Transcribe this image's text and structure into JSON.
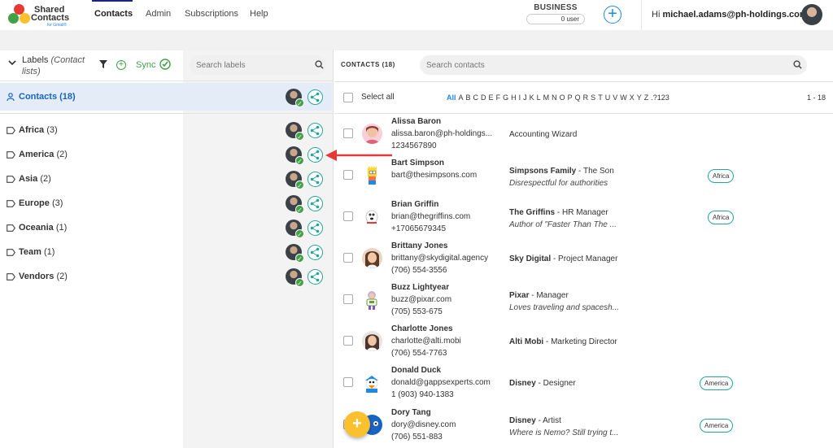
{
  "header": {
    "logo": {
      "line1": "Shared",
      "line2": "Contacts",
      "line3": "for Gmail®"
    },
    "nav": [
      "Contacts",
      "Admin",
      "Subscriptions",
      "Help"
    ],
    "plan_name": "BUSINESS",
    "plan_users": "0 user",
    "greeting_prefix": "Hi ",
    "greeting_email": "michael.adams@ph-holdings.com",
    "greeting_suffix": "!"
  },
  "labels_panel": {
    "title": "Labels",
    "title_italic": "(Contact lists)",
    "sync_label": "Sync",
    "search_placeholder": "Search labels",
    "contacts_item": "Contacts (18)",
    "items": [
      {
        "name": "Africa",
        "count": "(3)"
      },
      {
        "name": "America",
        "count": "(2)"
      },
      {
        "name": "Asia",
        "count": "(2)"
      },
      {
        "name": "Europe",
        "count": "(3)"
      },
      {
        "name": "Oceania",
        "count": "(1)"
      },
      {
        "name": "Team",
        "count": "(1)"
      },
      {
        "name": "Vendors",
        "count": "(2)"
      }
    ]
  },
  "contacts_panel": {
    "title": "CONTACTS (18)",
    "search_placeholder": "Search contacts",
    "select_all": "Select all",
    "alphabet": [
      "All",
      "A",
      "B",
      "C",
      "D",
      "E",
      "F",
      "G",
      "H",
      "I",
      "J",
      "K",
      "L",
      "M",
      "N",
      "O",
      "P",
      "Q",
      "R",
      "S",
      "T",
      "U",
      "V",
      "W",
      "X",
      "Y",
      "Z",
      ".?123"
    ],
    "range": "1 - 18",
    "contacts": [
      {
        "name": "Alissa Baron",
        "line2": "alissa.baron@ph-holdings...",
        "line3": "1234567890",
        "org": "",
        "role": "Accounting Wizard",
        "note": "",
        "label": ""
      },
      {
        "name": "Bart Simpson",
        "line2": "bart@thesimpsons.com",
        "line3": "",
        "org": "Simpsons Family",
        "role": " - The Son",
        "note": "Disrespectful for authorities",
        "label": "Africa"
      },
      {
        "name": "Brian Griffin",
        "line2": "brian@thegriffins.com",
        "line3": "+17065679345",
        "org": "The Griffins",
        "role": " - HR Manager",
        "note": "Author of \"Faster Than The ...",
        "label": "Africa"
      },
      {
        "name": "Brittany Jones",
        "line2": "brittany@skydigital.agency",
        "line3": "(706) 554-3556",
        "org": "Sky Digital",
        "role": " - Project Manager",
        "note": "",
        "label": ""
      },
      {
        "name": "Buzz Lightyear",
        "line2": "buzz@pixar.com",
        "line3": "(705) 553-675",
        "org": "Pixar",
        "role": " - Manager",
        "note": "Loves traveling and spacesh...",
        "label": ""
      },
      {
        "name": "Charlotte Jones",
        "line2": "charlotte@alti.mobi",
        "line3": "(706) 554-7763",
        "org": "Alti Mobi",
        "role": " - Marketing Director",
        "note": "",
        "label": ""
      },
      {
        "name": "Donald Duck",
        "line2": "donald@gappsexperts.com",
        "line3": "1 (903) 940-1383",
        "org": "Disney",
        "role": " - Designer",
        "note": "",
        "label": "America"
      },
      {
        "name": "Dory Tang",
        "line2": "dory@disney.com",
        "line3": "(706) 551-883",
        "org": "Disney",
        "role": " - Artist",
        "note": "Where is Nemo? Still trying t...",
        "label": "America"
      }
    ]
  },
  "fab_label": "+",
  "colors": {
    "accent": "#1e88e5",
    "green": "#43a047",
    "teal": "#26a69a",
    "selected_bg": "#e3ecf7",
    "arrow": "#e53935"
  }
}
